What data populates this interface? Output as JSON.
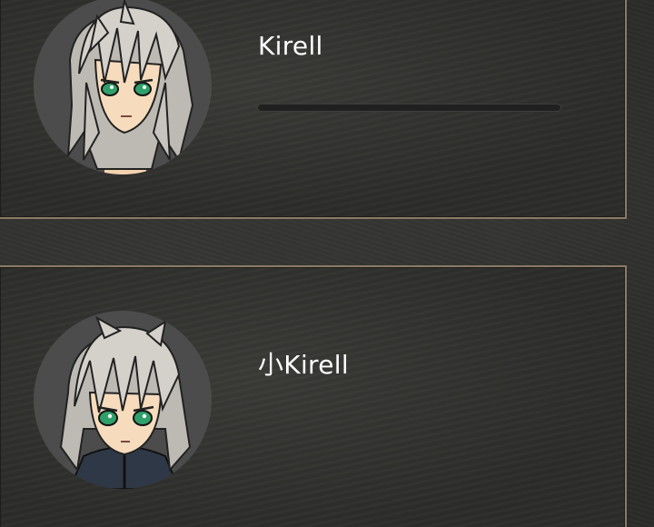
{
  "party": [
    {
      "name": "Kirell",
      "avatar_icon": "kirell-portrait-icon",
      "gauge_fraction": 0
    },
    {
      "name": "小Kirell",
      "avatar_icon": "kirell-child-portrait-icon"
    }
  ],
  "colors": {
    "panel_border": "#8c7a64",
    "hair": "#c7c4bd",
    "eyes": "#2fa06a",
    "gauge_track": "#202020"
  }
}
